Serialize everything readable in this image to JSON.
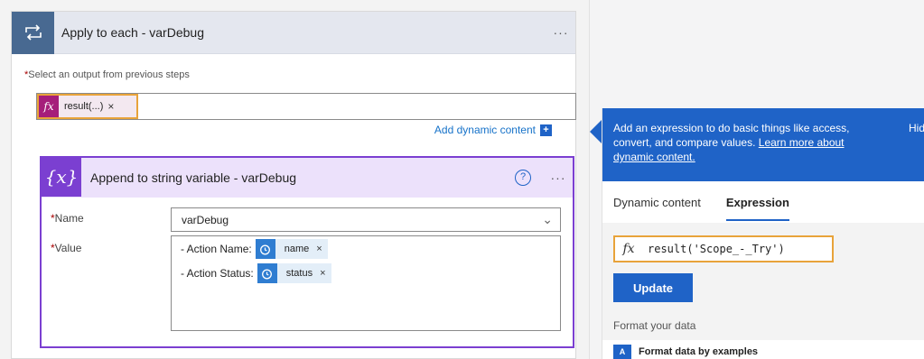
{
  "loop_card": {
    "title": "Apply to each - varDebug",
    "more": "···",
    "output_label": "Select an output from previous steps",
    "required_mark": "*",
    "token": {
      "icon": "fx",
      "label": "result(...)",
      "remove": "×"
    },
    "add_dynamic_label": "Add dynamic content",
    "add_dynamic_plus": "+"
  },
  "append_card": {
    "icon_text": "{x}",
    "title": "Append to string variable - varDebug",
    "help": "?",
    "more": "···",
    "name_label": "Name",
    "name_value": "varDebug",
    "value_label": "Value",
    "rows": [
      {
        "prefix": "- Action Name:",
        "token": "name",
        "remove": "×"
      },
      {
        "prefix": "- Action Status:",
        "token": "status",
        "remove": "×"
      }
    ]
  },
  "expression_pane": {
    "info_text": "Add an expression to do basic things like access, convert, and compare values.",
    "info_link": "Learn more about dynamic content.",
    "hide_label": "Hid",
    "tabs": [
      "Dynamic content",
      "Expression"
    ],
    "expression_value": "result('Scope_-_Try')",
    "update_label": "Update",
    "format_heading": "Format your data",
    "format_item": "Format data by examples"
  },
  "colors": {
    "loop_header_icon": "#486991",
    "append_accent": "#7b3fd1",
    "token_fx": "#a51e7a",
    "primary": "#1f63c7",
    "highlight": "#e8a33a"
  }
}
